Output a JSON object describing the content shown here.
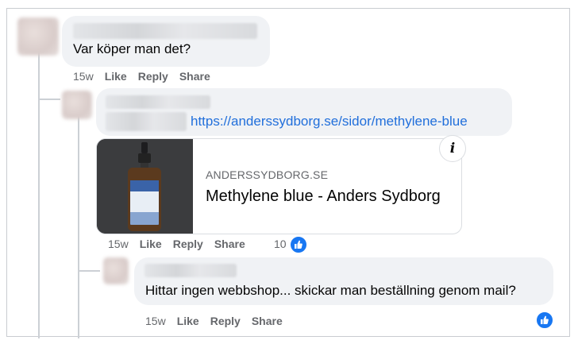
{
  "comments": [
    {
      "text": "Var köper man det?",
      "time": "15w",
      "like": "Like",
      "reply": "Reply",
      "share": "Share"
    },
    {
      "link": "https://anderssydborg.se/sidor/methylene-blue",
      "preview": {
        "domain": "ANDERSSYDBORG.SE",
        "title": "Methylene blue - Anders Sydborg",
        "info_glyph": "i"
      },
      "time": "15w",
      "like": "Like",
      "reply": "Reply",
      "share": "Share",
      "reaction_count": "10"
    },
    {
      "text": "Hittar ingen webbshop... skickar man beställning genom mail?",
      "time": "15w",
      "like": "Like",
      "reply": "Reply",
      "share": "Share"
    }
  ],
  "colors": {
    "link": "#216fdb",
    "like_badge": "#1877f2",
    "bubble": "#f0f2f5"
  },
  "icons": {
    "reaction": "like-reaction-icon",
    "info": "info-icon"
  }
}
